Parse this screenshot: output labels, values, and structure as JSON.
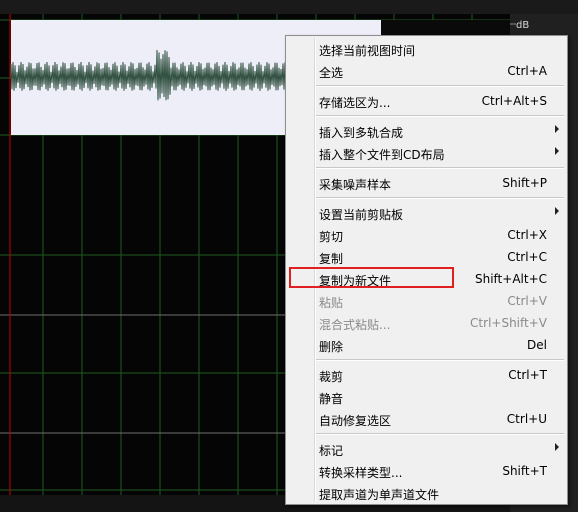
{
  "editor": {
    "db_label": "dB",
    "colors": {
      "waveform": "#2f4f3f",
      "selection": "#eeeef8",
      "grid": "#1f5a1f",
      "playhead": "#cc0000"
    }
  },
  "context_menu": {
    "items": [
      {
        "label": "选择当前视图时间",
        "shortcut": "",
        "submenu": false,
        "disabled": false
      },
      {
        "label": "全选",
        "shortcut": "Ctrl+A",
        "submenu": false,
        "disabled": false
      },
      {
        "label": "存储选区为...",
        "shortcut": "Ctrl+Alt+S",
        "submenu": false,
        "disabled": false
      },
      {
        "label": "插入到多轨合成",
        "shortcut": "",
        "submenu": true,
        "disabled": false
      },
      {
        "label": "插入整个文件到CD布局",
        "shortcut": "",
        "submenu": true,
        "disabled": false
      },
      {
        "label": "采集噪声样本",
        "shortcut": "Shift+P",
        "submenu": false,
        "disabled": false
      },
      {
        "label": "设置当前剪贴板",
        "shortcut": "",
        "submenu": true,
        "disabled": false
      },
      {
        "label": "剪切",
        "shortcut": "Ctrl+X",
        "submenu": false,
        "disabled": false
      },
      {
        "label": "复制",
        "shortcut": "Ctrl+C",
        "submenu": false,
        "disabled": false
      },
      {
        "label": "复制为新文件",
        "shortcut": "Shift+Alt+C",
        "submenu": false,
        "disabled": false
      },
      {
        "label": "粘贴",
        "shortcut": "Ctrl+V",
        "submenu": false,
        "disabled": true
      },
      {
        "label": "混合式粘贴...",
        "shortcut": "Ctrl+Shift+V",
        "submenu": false,
        "disabled": true
      },
      {
        "label": "删除",
        "shortcut": "Del",
        "submenu": false,
        "disabled": false
      },
      {
        "label": "裁剪",
        "shortcut": "Ctrl+T",
        "submenu": false,
        "disabled": false
      },
      {
        "label": "静音",
        "shortcut": "",
        "submenu": false,
        "disabled": false
      },
      {
        "label": "自动修复选区",
        "shortcut": "Ctrl+U",
        "submenu": false,
        "disabled": false
      },
      {
        "label": "标记",
        "shortcut": "",
        "submenu": true,
        "disabled": false
      },
      {
        "label": "转换采样类型...",
        "shortcut": "Shift+T",
        "submenu": false,
        "disabled": false
      },
      {
        "label": "提取声道为单声道文件",
        "shortcut": "",
        "submenu": false,
        "disabled": false
      }
    ],
    "highlight_color": "#e02020"
  }
}
